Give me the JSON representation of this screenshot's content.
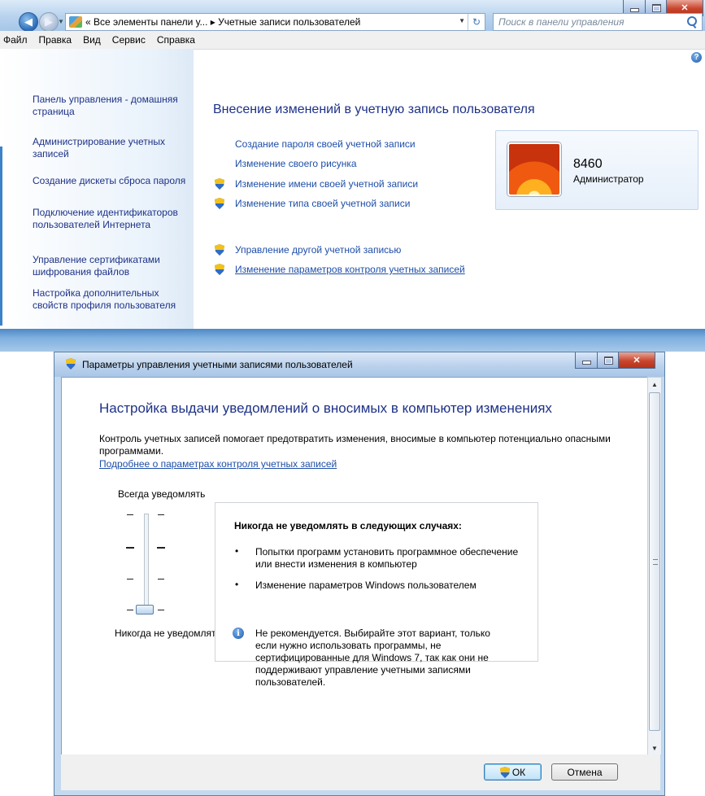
{
  "control_panel": {
    "address": {
      "path_text": "« Все элементы панели у... ▸ Учетные записи пользователей",
      "search_placeholder": "Поиск в панели управления"
    },
    "menu": [
      "Файл",
      "Правка",
      "Вид",
      "Сервис",
      "Справка"
    ],
    "sidebar": [
      "Панель управления - домашняя страница",
      "Администрирование учетных записей",
      "Создание дискеты сброса пароля",
      "Подключение идентификаторов пользователей Интернета",
      "Управление сертификатами шифрования файлов",
      "Настройка дополнительных свойств профиля пользователя"
    ],
    "heading": "Внесение изменений в учетную запись пользователя",
    "tasks": [
      "Создание пароля своей учетной записи",
      "Изменение своего рисунка",
      "Изменение имени своей учетной записи",
      "Изменение типа своей учетной записи"
    ],
    "other_tasks": [
      "Управление другой учетной записью",
      "Изменение параметров контроля учетных записей"
    ],
    "user": {
      "name": "8460",
      "role": "Администратор"
    }
  },
  "uac_dialog": {
    "title": "Параметры управления учетными записями пользователей",
    "heading": "Настройка выдачи уведомлений о вносимых в компьютер изменениях",
    "description": "Контроль учетных записей помогает предотвратить изменения, вносимые в компьютер потенциально опасными программами.",
    "learn_more": "Подробнее о параметрах контроля учетных записей",
    "slider": {
      "top_label": "Всегда уведомлять",
      "bottom_label": "Никогда не уведомлять",
      "levels": 4,
      "selected_level": 1
    },
    "info": {
      "title": "Никогда не уведомлять в следующих случаях:",
      "bullets": [
        "Попытки программ установить программное обеспечение или внести изменения в компьютер",
        "Изменение параметров Windows пользователем"
      ],
      "note": "Не рекомендуется. Выбирайте этот вариант, только если нужно использовать программы, не сертифицированные для Windows 7, так как они не поддерживают управление учетными записями пользователей."
    },
    "buttons": {
      "ok": "ОК",
      "cancel": "Отмена"
    }
  }
}
